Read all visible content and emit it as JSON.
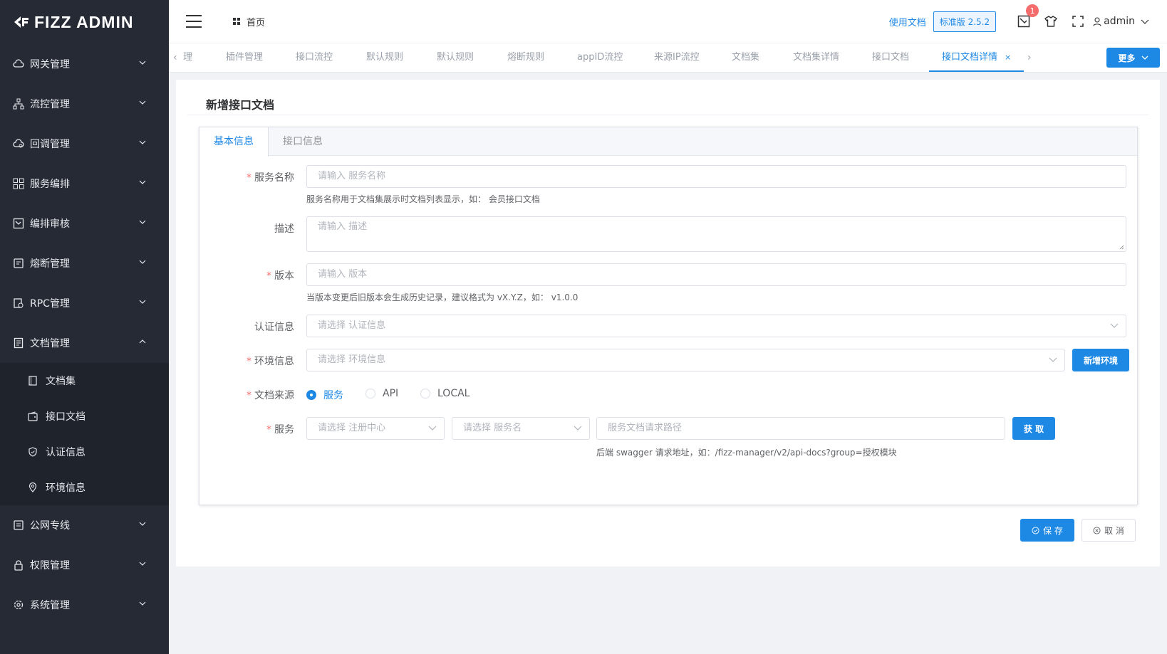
{
  "logo": {
    "text": "FIZZ ADMIN"
  },
  "sidebar": {
    "items": [
      {
        "label": "网关管理",
        "icon": "cloud-icon"
      },
      {
        "label": "流控管理",
        "icon": "hierarchy-icon"
      },
      {
        "label": "回调管理",
        "icon": "cloud-callback-icon"
      },
      {
        "label": "服务编排",
        "icon": "grid-icon"
      },
      {
        "label": "编排审核",
        "icon": "audit-icon"
      },
      {
        "label": "熔断管理",
        "icon": "circuit-breaker-icon"
      },
      {
        "label": "RPC管理",
        "icon": "rpc-icon"
      },
      {
        "label": "文档管理",
        "icon": "document-icon",
        "expanded": true
      },
      {
        "label": "公网专线",
        "icon": "public-network-icon"
      },
      {
        "label": "权限管理",
        "icon": "lock-icon"
      },
      {
        "label": "系统管理",
        "icon": "gear-icon"
      }
    ],
    "doc_sub_items": [
      {
        "label": "文档集",
        "icon": "book-icon"
      },
      {
        "label": "接口文档",
        "icon": "wallet-icon"
      },
      {
        "label": "认证信息",
        "icon": "shield-icon"
      },
      {
        "label": "环境信息",
        "icon": "location-icon"
      }
    ]
  },
  "header": {
    "breadcrumb": "首页",
    "doc_link": "使用文档",
    "version": "标准版 2.5.2",
    "notify_count": "1",
    "user": "admin"
  },
  "tabs": {
    "items": [
      "理",
      "插件管理",
      "接口流控",
      "默认规则",
      "默认规则",
      "熔断规则",
      "appID流控",
      "来源IP流控",
      "文档集",
      "文档集详情",
      "接口文档",
      "接口文档详情"
    ],
    "active_index": 11,
    "more_label": "更多"
  },
  "page": {
    "title": "新增接口文档",
    "form_tabs": [
      "基本信息",
      "接口信息"
    ],
    "active_form_tab": 0
  },
  "form": {
    "service_name": {
      "label": "服务名称",
      "placeholder": "请输入 服务名称",
      "hint": "服务名称用于文档集展示时文档列表显示，如： 会员接口文档",
      "required": true
    },
    "description": {
      "label": "描述",
      "placeholder": "请输入 描述",
      "required": false
    },
    "version": {
      "label": "版本",
      "placeholder": "请输入 版本",
      "hint": "当版本变更后旧版本会生成历史记录，建议格式为 vX.Y.Z，如： v1.0.0",
      "required": true
    },
    "auth": {
      "label": "认证信息",
      "placeholder": "请选择 认证信息",
      "required": false
    },
    "env": {
      "label": "环境信息",
      "placeholder": "请选择 环境信息",
      "button": "新增环境",
      "required": true
    },
    "source": {
      "label": "文档来源",
      "options": [
        "服务",
        "API",
        "LOCAL"
      ],
      "selected": 0,
      "required": true
    },
    "service": {
      "label": "服务",
      "registry_placeholder": "请选择 注册中心",
      "service_placeholder": "请选择 服务名",
      "path_placeholder": "服务文档请求路径",
      "fetch_button": "获 取",
      "hint": "后端 swagger 请求地址，如：/fizz-manager/v2/api-docs?group=授权模块",
      "required": true
    }
  },
  "actions": {
    "save": "保 存",
    "cancel": "取 消"
  },
  "colors": {
    "primary": "#1e88e5",
    "sidebar_bg": "#252a34",
    "required": "#f56c6c"
  }
}
